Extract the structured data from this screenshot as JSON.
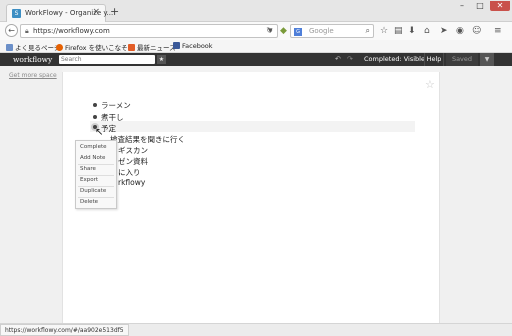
{
  "browser": {
    "tab_title": "WorkFlowy - Organize y...",
    "tab_close": "×",
    "new_tab": "+",
    "window_controls": {
      "minimize": "–",
      "maximize": "□",
      "close": "✕"
    },
    "url": "https://workflowy.com",
    "search_placeholder": "Google",
    "search_engine_label": "G"
  },
  "bookmarks": [
    {
      "label": "よく見るページ",
      "color": "#6b8fc8"
    },
    {
      "label": "Firefox を使いこなそう",
      "color": "#e66000"
    },
    {
      "label": "最新ニュース",
      "color": "#e25c26"
    },
    {
      "label": "Facebook",
      "color": "#3b5998"
    }
  ],
  "workflowy": {
    "logo": "workflowy",
    "search_placeholder": "Search",
    "star": "★",
    "undo": "↶",
    "redo": "↷",
    "completed_label": "Completed: Visible",
    "help_label": "Help",
    "saved_label": "Saved",
    "menu_caret": "▼",
    "get_more_space": "Get more space"
  },
  "outline": {
    "items": [
      {
        "text": "ラーメン"
      },
      {
        "text": "煮干し"
      },
      {
        "text": "予定"
      },
      {
        "text": "検査結果を聞きに行く"
      },
      {
        "text": "ギスカン"
      },
      {
        "text": "ゼン資料"
      },
      {
        "text": "に入り"
      },
      {
        "text": "rkflowy"
      }
    ]
  },
  "context_menu": {
    "items": [
      "Complete",
      "Add Note",
      "Share",
      "Export",
      "Duplicate",
      "Delete"
    ]
  },
  "status_bar": {
    "url": "https://workflowy.com/#/aa902e513df5"
  },
  "colors": {
    "header_bg": "#333333",
    "close_button": "#c9514b"
  }
}
